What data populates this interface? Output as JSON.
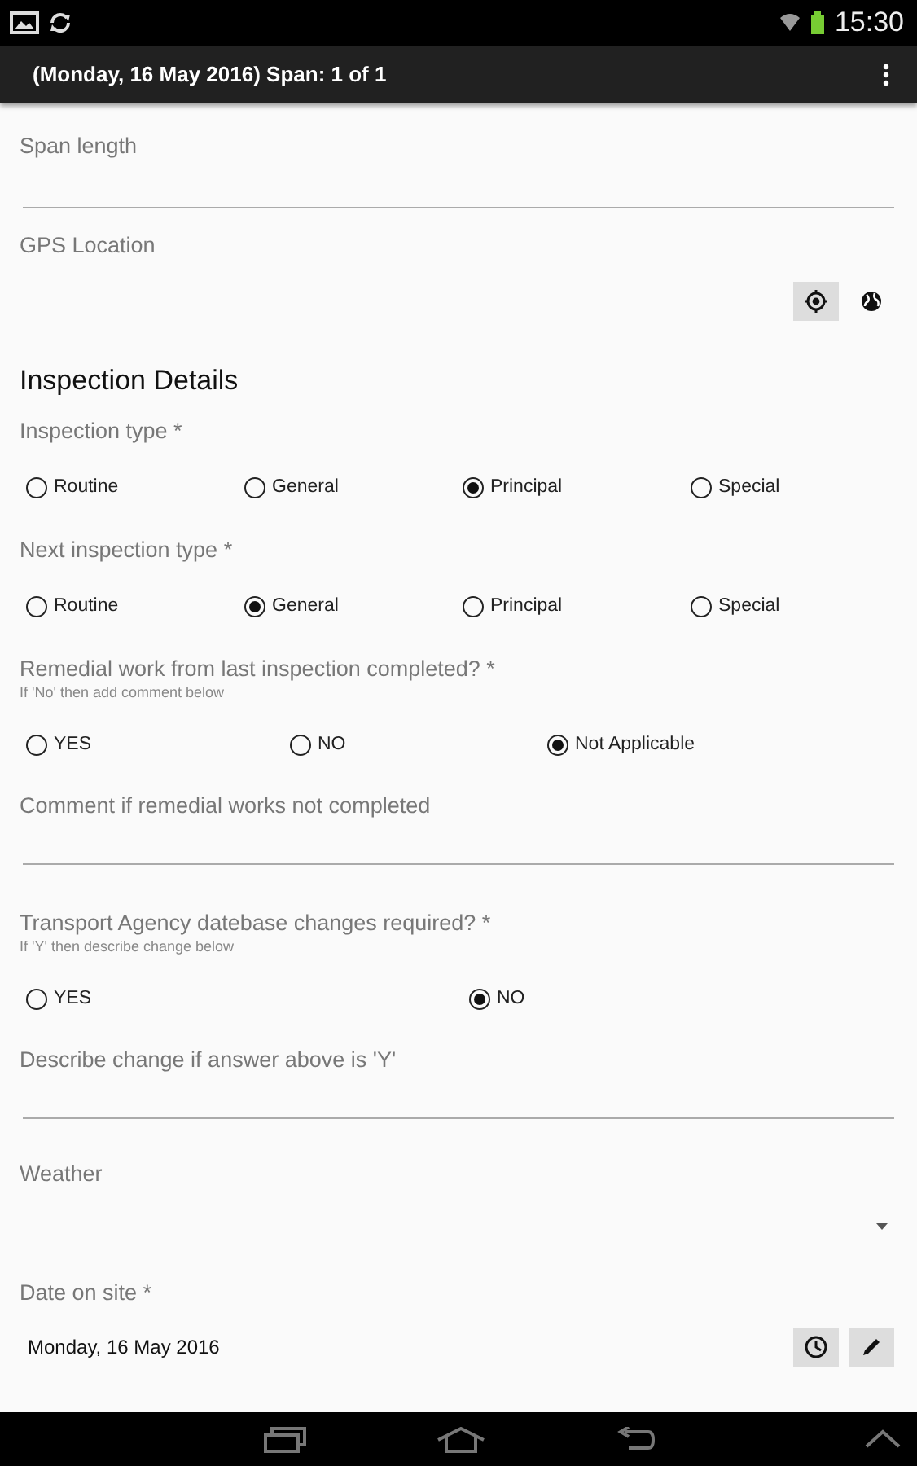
{
  "status_bar": {
    "time": "15:30"
  },
  "action_bar": {
    "title": "(Monday, 16 May 2016) Span: 1 of 1"
  },
  "form": [
    {
      "kind": "text",
      "label": "Span length"
    },
    {
      "kind": "gps",
      "label": "GPS Location"
    },
    {
      "kind": "heading",
      "label": "Inspection Details"
    },
    {
      "kind": "radio",
      "label": "Inspection type *",
      "options": [
        {
          "label": "Routine",
          "selected": false
        },
        {
          "label": "General",
          "selected": false
        },
        {
          "label": "Principal",
          "selected": true
        },
        {
          "label": "Special",
          "selected": false
        }
      ]
    },
    {
      "kind": "radio",
      "label": "Next inspection type *",
      "options": [
        {
          "label": "Routine",
          "selected": false
        },
        {
          "label": "General",
          "selected": true
        },
        {
          "label": "Principal",
          "selected": false
        },
        {
          "label": "Special",
          "selected": false
        }
      ]
    },
    {
      "kind": "radio",
      "label": "Remedial work from last inspection completed? *",
      "hint": "If 'No' then add comment below",
      "options": [
        {
          "label": "YES",
          "selected": false
        },
        {
          "label": "NO",
          "selected": false
        },
        {
          "label": "Not Applicable",
          "selected": true
        }
      ]
    },
    {
      "kind": "text",
      "label": "Comment if remedial works not completed"
    },
    {
      "kind": "radio",
      "label": "Transport Agency datebase changes required? *",
      "hint": "If 'Y' then describe change below",
      "options": [
        {
          "label": "YES",
          "selected": false
        },
        {
          "label": "NO",
          "selected": true
        }
      ]
    },
    {
      "kind": "text",
      "label": "Describe change if answer above is 'Y'"
    },
    {
      "kind": "dropdown",
      "label": "Weather"
    },
    {
      "kind": "date",
      "label": "Date on site *",
      "value": "Monday, 16 May 2016"
    }
  ]
}
